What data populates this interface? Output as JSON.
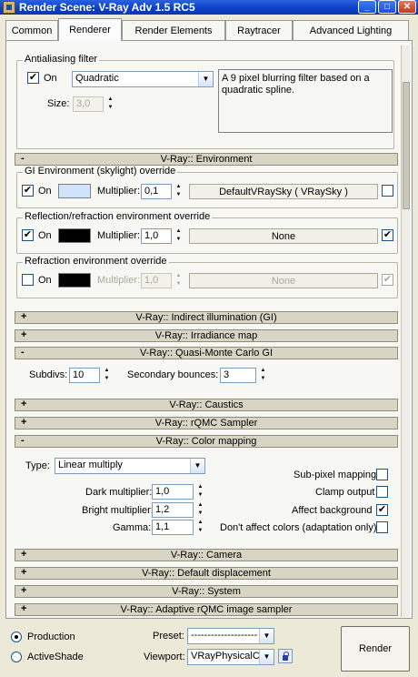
{
  "window": {
    "title": "Render Scene: V-Ray Adv 1.5 RC5"
  },
  "tabs": [
    "Common",
    "Renderer",
    "Render Elements",
    "Raytracer",
    "Advanced Lighting"
  ],
  "antialias": {
    "group_label": "Antialiasing filter",
    "on_label": "On",
    "on_checked": true,
    "filter": "Quadratic",
    "size_label": "Size:",
    "size_value": "3,0",
    "description": "A 9 pixel blurring filter based on a quadratic spline."
  },
  "environment": {
    "rollout": "V-Ray:: Environment",
    "sign": "-",
    "gi": {
      "label": "GI Environment (skylight) override",
      "on_label": "On",
      "on_checked": true,
      "color": "#cfe4fb",
      "multiplier_label": "Multiplier:",
      "multiplier": "0,1",
      "map": "DefaultVRaySky  ( VRaySky )",
      "map_checked": false
    },
    "refl": {
      "label": "Reflection/refraction environment override",
      "on_label": "On",
      "on_checked": true,
      "color": "#000000",
      "multiplier_label": "Multiplier:",
      "multiplier": "1,0",
      "map": "None",
      "map_checked": true
    },
    "refr": {
      "label": "Refraction environment override",
      "on_label": "On",
      "on_checked": false,
      "color": "#000000",
      "multiplier_label": "Multiplier:",
      "multiplier": "1,0",
      "map": "None",
      "map_checked": true
    }
  },
  "rollouts": {
    "indirect": {
      "sign": "+",
      "title": "V-Ray:: Indirect illumination (GI)"
    },
    "irradiance": {
      "sign": "+",
      "title": "V-Ray:: Irradiance map"
    },
    "qmc": {
      "sign": "-",
      "title": "V-Ray:: Quasi-Monte Carlo GI"
    },
    "caustics": {
      "sign": "+",
      "title": "V-Ray:: Caustics"
    },
    "rqmc": {
      "sign": "+",
      "title": "V-Ray:: rQMC Sampler"
    },
    "colormap": {
      "sign": "-",
      "title": "V-Ray:: Color mapping"
    },
    "camera": {
      "sign": "+",
      "title": "V-Ray:: Camera"
    },
    "displacement": {
      "sign": "+",
      "title": "V-Ray:: Default displacement"
    },
    "system": {
      "sign": "+",
      "title": "V-Ray:: System"
    },
    "adaptive": {
      "sign": "+",
      "title": "V-Ray:: Adaptive rQMC image sampler"
    }
  },
  "qmc": {
    "subdivs_label": "Subdivs:",
    "subdivs": "10",
    "secondary_label": "Secondary bounces:",
    "secondary": "3"
  },
  "colormap": {
    "type_label": "Type:",
    "type": "Linear multiply",
    "dark_label": "Dark multiplier:",
    "dark": "1,0",
    "bright_label": "Bright multiplier:",
    "bright": "1,2",
    "gamma_label": "Gamma:",
    "gamma": "1,1",
    "subpixel_label": "Sub-pixel mapping",
    "subpixel": false,
    "clamp_label": "Clamp output",
    "clamp": false,
    "affect_bg_label": "Affect background",
    "affect_bg": true,
    "dont_affect_label": "Don't affect colors (adaptation only)",
    "dont_affect": false
  },
  "bottom": {
    "production_label": "Production",
    "production_selected": true,
    "activeshade_label": "ActiveShade",
    "preset_label": "Preset:",
    "preset": "--------------------",
    "viewport_label": "Viewport:",
    "viewport": "VRayPhysicalC",
    "render_label": "Render"
  }
}
